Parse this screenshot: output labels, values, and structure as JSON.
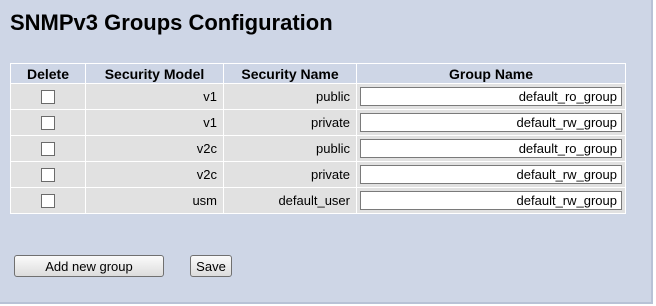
{
  "page": {
    "title": "SNMPv3 Groups Configuration"
  },
  "table": {
    "headers": {
      "delete": "Delete",
      "security_model": "Security Model",
      "security_name": "Security Name",
      "group_name": "Group Name"
    },
    "rows": [
      {
        "security_model": "v1",
        "security_name": "public",
        "group_name": "default_ro_group"
      },
      {
        "security_model": "v1",
        "security_name": "private",
        "group_name": "default_rw_group"
      },
      {
        "security_model": "v2c",
        "security_name": "public",
        "group_name": "default_ro_group"
      },
      {
        "security_model": "v2c",
        "security_name": "private",
        "group_name": "default_rw_group"
      },
      {
        "security_model": "usm",
        "security_name": "default_user",
        "group_name": "default_rw_group"
      }
    ]
  },
  "buttons": {
    "add_new_group": "Add new group",
    "save": "Save"
  },
  "colors": {
    "panel_bg": "#ced6e6",
    "row_bg": "#e1e1e1"
  }
}
